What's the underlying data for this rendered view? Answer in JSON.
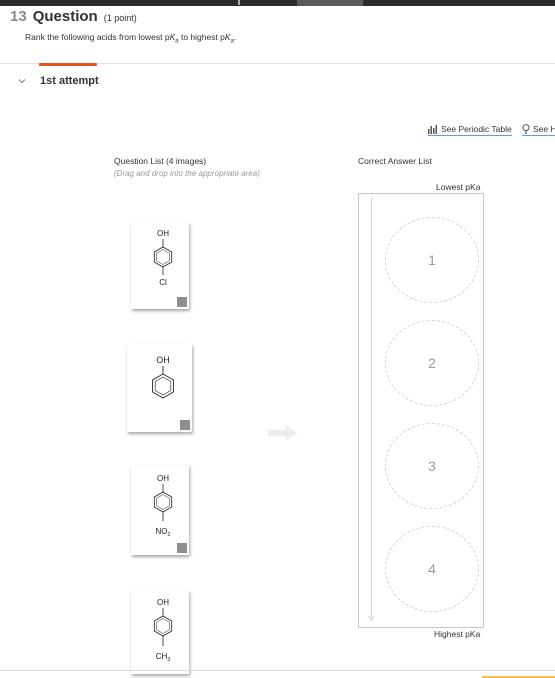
{
  "question": {
    "number": "13",
    "word": "Question",
    "points": "(1 point)",
    "prompt_pre": "Rank the following acids from lowest p",
    "pka_K": "K",
    "pka_sub": "a",
    "prompt_mid": " to highest p",
    "prompt_end": "."
  },
  "attempt": {
    "label": "1st attempt"
  },
  "links": {
    "periodic_table": "See Periodic Table",
    "hint": "See H"
  },
  "question_list": {
    "title": "Question List (4 images)",
    "subtitle": "(Drag and drop into the appropriate area)",
    "items": [
      {
        "top": "OH",
        "bottom": "Cl"
      },
      {
        "top": "OH",
        "bottom": ""
      },
      {
        "top": "OH",
        "bottom": "NO",
        "bottom_sub": "2"
      },
      {
        "top": "OH",
        "bottom": "CH",
        "bottom_sub": "3"
      }
    ]
  },
  "answer_list": {
    "title": "Correct Answer List",
    "lowest_label": "Lowest pKa",
    "highest_label": "Highest pKa",
    "slots": [
      "1",
      "2",
      "3",
      "4"
    ]
  },
  "colors": {
    "accent_orange": "#e8531f",
    "link_underline": "#6d9ad4"
  }
}
